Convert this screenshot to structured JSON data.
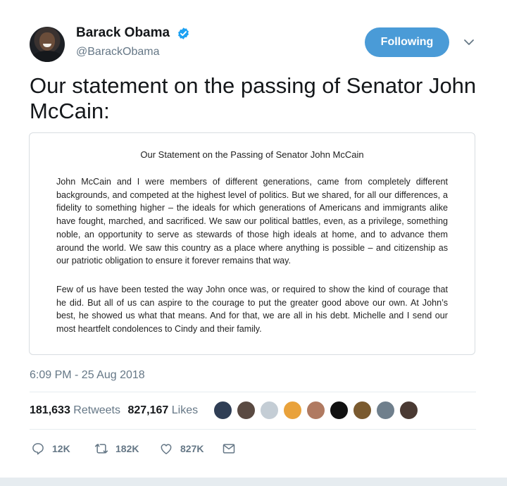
{
  "author": {
    "name": "Barack Obama",
    "handle": "@BarackObama",
    "verified": true
  },
  "follow_button_label": "Following",
  "tweet_text": "Our statement on the passing of Senator John McCain:",
  "statement_card": {
    "title": "Our Statement on the Passing of Senator John McCain",
    "paragraphs": [
      "John McCain and I were members of different generations, came from completely different backgrounds, and competed at the highest level of politics. But we shared, for all our differences, a fidelity to something higher – the ideals for which generations of Americans and immigrants alike have fought, marched, and sacrificed. We saw our political battles, even, as a privilege, something noble, an opportunity to serve as stewards of those high ideals at home, and to advance them around the world. We saw this country as a place where anything is possible – and citizenship as our patriotic obligation to ensure it forever remains that way.",
      "Few of us have been tested the way John once was, or required to show the kind of courage that he did. But all of us can aspire to the courage to put the greater good above our own. At John’s best, he showed us what that means. And for that, we are all in his debt. Michelle and I send our most heartfelt condolences to Cindy and their family."
    ]
  },
  "timestamp": "6:09 PM - 25 Aug 2018",
  "stats": {
    "retweets_count": "181,633",
    "retweets_label": "Retweets",
    "likes_count": "827,167",
    "likes_label": "Likes"
  },
  "likers": [
    {
      "icon": "liker-avatar-1",
      "color": "#2f3e55"
    },
    {
      "icon": "liker-avatar-2",
      "color": "#5a4a42"
    },
    {
      "icon": "liker-avatar-default",
      "color": "#c4cdd5"
    },
    {
      "icon": "liker-avatar-rainbow",
      "color": "#e9a23b"
    },
    {
      "icon": "liker-avatar-5",
      "color": "#b07a61"
    },
    {
      "icon": "liker-avatar-gear",
      "color": "#111111"
    },
    {
      "icon": "liker-avatar-7",
      "color": "#7a5a2f"
    },
    {
      "icon": "liker-avatar-8",
      "color": "#6f7f8c"
    },
    {
      "icon": "liker-avatar-9",
      "color": "#4a3a33"
    }
  ],
  "actions": {
    "replies": "12K",
    "retweets": "182K",
    "likes": "827K"
  },
  "colors": {
    "accent": "#4a9bd7",
    "verified": "#1da1f2",
    "muted_text": "#657786"
  }
}
